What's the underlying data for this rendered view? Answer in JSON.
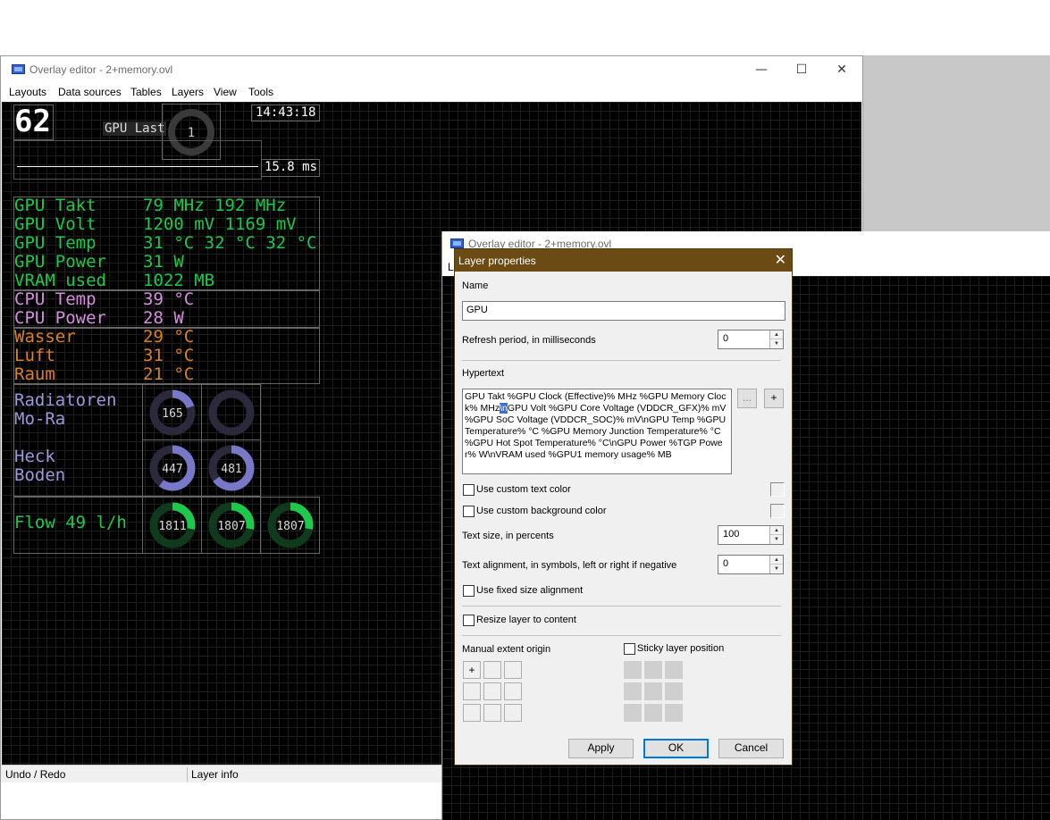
{
  "main_window": {
    "title": "Overlay editor - 2+memory.ovl",
    "caption": {
      "minimize": "—",
      "maximize": "☐",
      "close": "✕"
    },
    "menu": [
      "Layouts",
      "Data sources",
      "Tables",
      "Layers",
      "View",
      "Tools"
    ],
    "status": {
      "left": "Undo / Redo",
      "right": "Layer info"
    },
    "second_window_title": "Overlay editor - 2+memory.ovl",
    "second_menu_fragment": "L"
  },
  "overlay": {
    "fps": "62",
    "gpu_load_label": "GPU Last",
    "gpu_load_value": "1",
    "clock": "14:43:18",
    "frametime": "15.8 ms",
    "rows": [
      {
        "label": "GPU Takt",
        "value": "79 MHz 192 MHz",
        "color": "#1ec84a"
      },
      {
        "label": "GPU Volt",
        "value": "1200 mV  1169 mV",
        "color": "#1ec84a"
      },
      {
        "label": "GPU Temp",
        "value": "31 °C 32 °C 32 °C",
        "color": "#1ec84a"
      },
      {
        "label": "GPU Power",
        "value": "31 W",
        "color": "#1ec84a"
      },
      {
        "label": "VRAM used",
        "value": "1022 MB",
        "color": "#1ec84a"
      },
      {
        "label": "CPU Temp",
        "value": "39 °C",
        "color": "#d68ee0"
      },
      {
        "label": "CPU Power",
        "value": "28 W",
        "color": "#d68ee0"
      },
      {
        "label": "Wasser",
        "value": "29 °C",
        "color": "#d9802a"
      },
      {
        "label": "Luft",
        "value": "31 °C",
        "color": "#d9802a"
      },
      {
        "label": "Raum",
        "value": "21 °C",
        "color": "#d9802a"
      }
    ],
    "radiator_label_1": "Radiatoren",
    "radiator_label_2": "Mo-Ra",
    "radiator_gauges": [
      {
        "value": "165",
        "fill": 0.2
      },
      {
        "value": "",
        "fill": 0.0
      }
    ],
    "rear_label_1": "Heck",
    "rear_label_2": "Boden",
    "rear_gauges": [
      {
        "value": "447",
        "fill": 0.6
      },
      {
        "value": "481",
        "fill": 0.65
      }
    ],
    "flow_label": "Flow 49 l/h",
    "flow_gauges": [
      {
        "value": "1811",
        "fill": 0.28
      },
      {
        "value": "1807",
        "fill": 0.28
      },
      {
        "value": "1807",
        "fill": 0.28
      }
    ]
  },
  "dialog": {
    "title": "Layer properties",
    "close": "✕",
    "name_label": "Name",
    "name_value": "GPU",
    "refresh_label": "Refresh period, in milliseconds",
    "refresh_value": "0",
    "hypertext_label": "Hypertext",
    "hypertext_before": "GPU Takt     %GPU Clock (Effective)% MHz %GPU Memory Clock% MHz",
    "hypertext_selected": "\\n",
    "hypertext_after": "GPU Volt     %GPU Core Voltage (VDDCR_GFX)% mV  %GPU SoC Voltage (VDDCR_SOC)% mV\\nGPU Temp     %GPU Temperature% °C %GPU Memory Junction Temperature% °C %GPU Hot Spot Temperature% °C\\nGPU Power     %TGP Power% W\\nVRAM used     %GPU1 memory usage% MB",
    "browse_button": "...",
    "add_button": "+",
    "custom_text_color": "Use custom text color",
    "custom_bg_color": "Use custom background color",
    "text_size_label": "Text size, in percents",
    "text_size_value": "100",
    "alignment_label": "Text alignment, in symbols, left or right if negative",
    "alignment_value": "0",
    "fixed_alignment": "Use fixed size alignment",
    "resize_layer": "Resize layer to content",
    "extent_label": "Manual extent origin",
    "extent_marker": "+",
    "sticky_label": "Sticky layer position",
    "apply": "Apply",
    "ok": "OK",
    "cancel": "Cancel"
  }
}
